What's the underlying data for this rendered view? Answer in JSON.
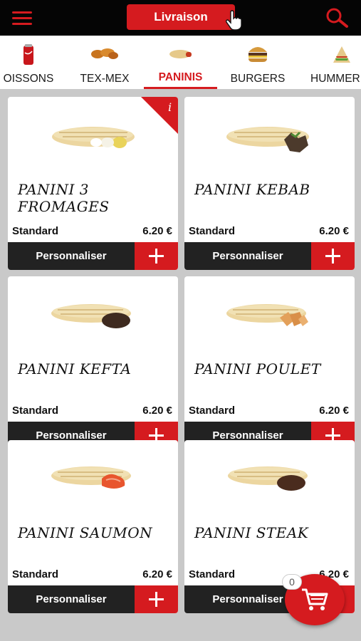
{
  "header": {
    "delivery_label": "Livraison"
  },
  "categories": [
    {
      "label": "OISSONS",
      "icon": "soda-can-icon"
    },
    {
      "label": "TEX-MEX",
      "icon": "chicken-wings-icon"
    },
    {
      "label": "PANINIS",
      "icon": "panini-icon",
      "active": true
    },
    {
      "label": "BURGERS",
      "icon": "burger-icon"
    },
    {
      "label": "HUMMER",
      "icon": "sandwich-icon"
    }
  ],
  "products": [
    {
      "name": "PANINI 3 FROMAGES",
      "size": "Standard",
      "price": "6.20 €",
      "customize": "Personnaliser",
      "info": "i"
    },
    {
      "name": "PANINI KEBAB",
      "size": "Standard",
      "price": "6.20 €",
      "customize": "Personnaliser"
    },
    {
      "name": "PANINI KEFTA",
      "size": "Standard",
      "price": "6.20 €",
      "customize": "Personnaliser"
    },
    {
      "name": "PANINI POULET",
      "size": "Standard",
      "price": "6.20 €",
      "customize": "Personnaliser"
    },
    {
      "name": "PANINI SAUMON",
      "size": "Standard",
      "price": "6.20 €",
      "customize": "Personnaliser"
    },
    {
      "name": "PANINI STEAK",
      "size": "Standard",
      "price": "6.20 €",
      "customize": "Personnaliser"
    }
  ],
  "cart": {
    "count": "0"
  },
  "colors": {
    "accent": "#d51b1f",
    "dark": "#222222",
    "topbar": "#050505"
  }
}
